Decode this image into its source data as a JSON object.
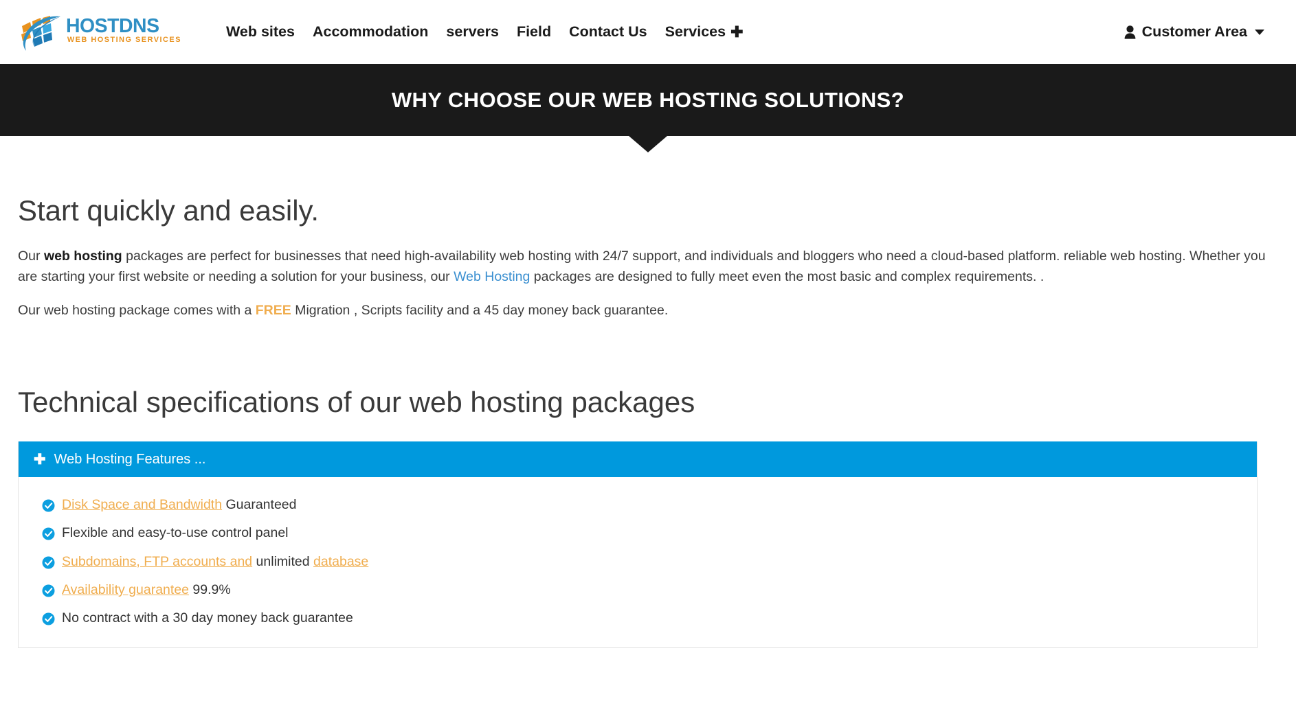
{
  "header": {
    "logo": {
      "name": "hostdns-logo",
      "wordmark": "HOSTDNS",
      "tagline": "WEB HOSTING SERVICES",
      "colors": {
        "orange": "#e8921f",
        "blue": "#1f7ab5",
        "light_blue": "#38a8e0"
      }
    },
    "nav": [
      {
        "label": "Web sites",
        "icon": ""
      },
      {
        "label": "Accommodation",
        "icon": ""
      },
      {
        "label": "servers",
        "icon": ""
      },
      {
        "label": "Field",
        "icon": ""
      },
      {
        "label": "Contact Us",
        "icon": ""
      },
      {
        "label": "Services",
        "icon": "plus-icon"
      }
    ],
    "account": {
      "label": "Customer Area",
      "icon": "user-icon",
      "caret": "chevron-down-icon"
    }
  },
  "banner": {
    "title": "WHY CHOOSE OUR WEB HOSTING SOLUTIONS?",
    "background": "#1a1a1a"
  },
  "main": {
    "heading_1": "Start quickly and easily.",
    "paragraph_1": {
      "part_1": "Our ",
      "bold_1": "web hosting",
      "part_2": " packages are perfect for businesses that need high-availability web hosting with 24/7 support, and individuals and bloggers who need a cloud-based platform. reliable web hosting. Whether you are starting your first website or needing a solution for your business, our ",
      "link": "Web Hosting",
      "part_3": " packages are designed to fully meet even the most basic and complex requirements. ."
    },
    "paragraph_2": {
      "part_1": "Our web hosting package comes with a ",
      "highlight": "FREE",
      "part_2": " Migration , Scripts facility and a 45 day money back guarantee."
    },
    "heading_2": "Technical specifications of our web hosting packages",
    "panel": {
      "header_label": "Web Hosting Features ...",
      "header_icon": "plus-icon",
      "header_color": "#0099dd",
      "features": [
        {
          "icon": "check-circle-icon",
          "segments": [
            {
              "text": "Disk Space and Bandwidth",
              "style": "orange"
            },
            {
              "text": " Guaranteed",
              "style": "dark"
            }
          ]
        },
        {
          "icon": "check-circle-icon",
          "segments": [
            {
              "text": "Flexible and easy-to-use control panel",
              "style": "dark"
            }
          ]
        },
        {
          "icon": "check-circle-icon",
          "segments": [
            {
              "text": "Subdomains, FTP accounts and",
              "style": "orange"
            },
            {
              "text": " unlimited ",
              "style": "dark"
            },
            {
              "text": "database",
              "style": "orange"
            }
          ]
        },
        {
          "icon": "check-circle-icon",
          "segments": [
            {
              "text": "Availability guarantee",
              "style": "orange"
            },
            {
              "text": " 99.9%",
              "style": "dark"
            }
          ]
        },
        {
          "icon": "check-circle-icon",
          "segments": [
            {
              "text": "No contract with a 30 day money back guarantee",
              "style": "dark"
            }
          ]
        }
      ]
    }
  },
  "colors": {
    "accent_blue": "#0099dd",
    "link_blue": "#3a8fd0",
    "orange": "#f0ad4e",
    "dark": "#1a1a1a"
  }
}
